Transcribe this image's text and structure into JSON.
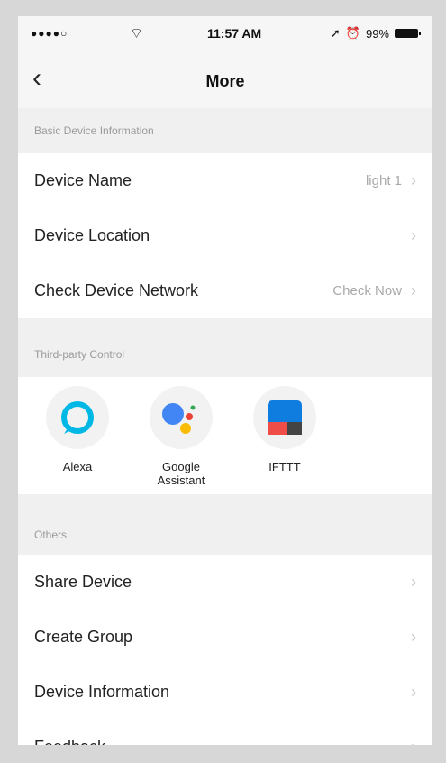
{
  "status_bar": {
    "signal": "●●●●○",
    "time": "11:57 AM",
    "battery": "99%"
  },
  "nav": {
    "title": "More"
  },
  "sections": {
    "basic": "Basic Device Information",
    "third_party": "Third-party Control",
    "others": "Others"
  },
  "basic_rows": [
    {
      "label": "Device Name",
      "value": "light 1"
    },
    {
      "label": "Device Location",
      "value": ""
    },
    {
      "label": "Check Device Network",
      "value": "Check Now"
    }
  ],
  "third_party_services": [
    {
      "label": "Alexa"
    },
    {
      "label": "Google\nAssistant"
    },
    {
      "label": "IFTTT"
    }
  ],
  "others_rows": [
    {
      "label": "Share Device"
    },
    {
      "label": "Create Group"
    },
    {
      "label": "Device Information"
    },
    {
      "label": "Feedback"
    }
  ],
  "colors": {
    "alexa": "#00b8e6",
    "google_blue": "#4285f4",
    "google_red": "#ea4335",
    "google_yellow": "#fbbc05",
    "google_green": "#34a853",
    "ifttt_blue": "#0f7de0",
    "ifttt_red": "#ef4d47",
    "ifttt_dark": "#444444"
  }
}
